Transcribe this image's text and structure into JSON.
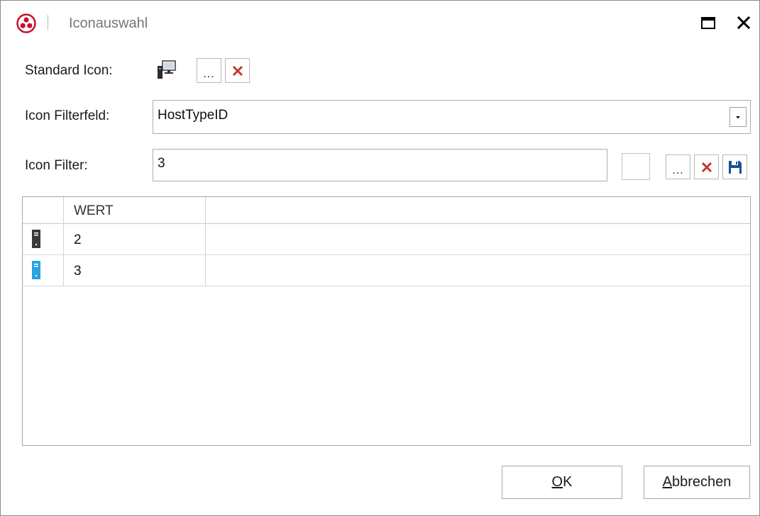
{
  "window": {
    "title": "Iconauswahl"
  },
  "standard_icon": {
    "label": "Standard Icon:",
    "icon": "computer-monitor-icon"
  },
  "icon_filter_field": {
    "label": "Icon Filterfeld:",
    "value": "HostTypeID"
  },
  "icon_filter": {
    "label": "Icon Filter:",
    "value": "3"
  },
  "buttons": {
    "browse": "...",
    "remove": "delete-x-icon",
    "save": "save-disk-icon"
  },
  "grid": {
    "columns": [
      "WERT"
    ],
    "rows": [
      {
        "value": "2",
        "icon": "server-tower-icon",
        "icon_color": "#3a3a3a"
      },
      {
        "value": "3",
        "icon": "server-tower-icon",
        "icon_color": "#29a3e0"
      }
    ]
  },
  "dialog": {
    "ok_mnemonic": "O",
    "ok_rest": "K",
    "cancel_mnemonic": "A",
    "cancel_rest": "bbrechen"
  },
  "colors": {
    "logo": "#c8102e",
    "delete": "#c0392b",
    "save": "#1a4fa0"
  }
}
